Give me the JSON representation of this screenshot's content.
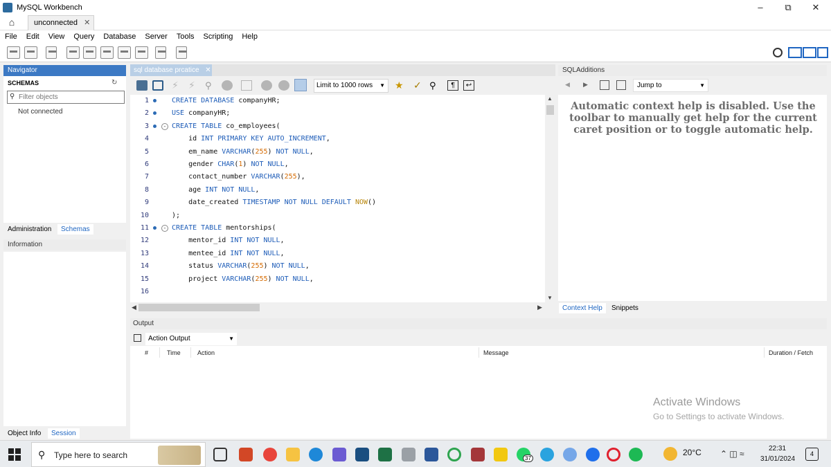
{
  "window": {
    "title": "MySQL Workbench",
    "minimize": "–",
    "maximize": "⧉",
    "close": "✕"
  },
  "tabs": {
    "connection_tab": "unconnected",
    "close": "✕"
  },
  "menu": [
    "File",
    "Edit",
    "View",
    "Query",
    "Database",
    "Server",
    "Tools",
    "Scripting",
    "Help"
  ],
  "navigator": {
    "header": "Navigator",
    "schemas_label": "SCHEMAS",
    "filter_placeholder": "Filter objects",
    "status": "Not connected",
    "tabs": [
      "Administration",
      "Schemas"
    ],
    "info_header": "Information",
    "info_tabs": [
      "Object Info",
      "Session"
    ]
  },
  "editor": {
    "tab_label": "sql database prcatice",
    "tab_close": "✕",
    "limit_select": "Limit to 1000 rows",
    "lines": [
      {
        "n": "1",
        "dot": true,
        "fold": false,
        "html": "<span class='kw'>CREATE DATABASE</span> companyHR;"
      },
      {
        "n": "2",
        "dot": true,
        "fold": false,
        "html": "<span class='kw'>USE</span> companyHR;"
      },
      {
        "n": "3",
        "dot": true,
        "fold": true,
        "html": "<span class='kw'>CREATE TABLE</span> co_employees("
      },
      {
        "n": "4",
        "dot": false,
        "fold": false,
        "html": "    id <span class='kw'>INT PRIMARY KEY AUTO_INCREMENT</span>,"
      },
      {
        "n": "5",
        "dot": false,
        "fold": false,
        "html": "    em_name <span class='kw'>VARCHAR</span>(<span class='num'>255</span>) <span class='kw'>NOT NULL</span>,"
      },
      {
        "n": "6",
        "dot": false,
        "fold": false,
        "html": "    gender <span class='kw'>CHAR</span>(<span class='num'>1</span>) <span class='kw'>NOT NULL</span>,"
      },
      {
        "n": "7",
        "dot": false,
        "fold": false,
        "html": "    contact_number <span class='kw'>VARCHAR</span>(<span class='num'>255</span>),"
      },
      {
        "n": "8",
        "dot": false,
        "fold": false,
        "html": "    age <span class='kw'>INT NOT NULL</span>,"
      },
      {
        "n": "9",
        "dot": false,
        "fold": false,
        "html": "    date_created <span class='kw'>TIMESTAMP NOT NULL DEFAULT</span> <span class='fn'>NOW</span>()"
      },
      {
        "n": "10",
        "dot": false,
        "fold": false,
        "html": ");"
      },
      {
        "n": "11",
        "dot": true,
        "fold": true,
        "html": "<span class='kw'>CREATE TABLE</span> mentorships("
      },
      {
        "n": "12",
        "dot": false,
        "fold": false,
        "html": "    mentor_id <span class='kw'>INT NOT NULL</span>,"
      },
      {
        "n": "13",
        "dot": false,
        "fold": false,
        "html": "    mentee_id <span class='kw'>INT NOT NULL</span>,"
      },
      {
        "n": "14",
        "dot": false,
        "fold": false,
        "html": "    status <span class='kw'>VARCHAR</span>(<span class='num'>255</span>) <span class='kw'>NOT NULL</span>,"
      },
      {
        "n": "15",
        "dot": false,
        "fold": false,
        "html": "    project <span class='kw'>VARCHAR</span>(<span class='num'>255</span>) <span class='kw'>NOT NULL</span>,"
      },
      {
        "n": "16",
        "dot": false,
        "fold": false,
        "html": ""
      }
    ]
  },
  "sql_additions": {
    "header": "SQLAdditions",
    "jump_to": "Jump to",
    "help_text": "Automatic context help is disabled. Use the toolbar to manually get help for the current caret position or to toggle automatic help.",
    "tabs": [
      "Context Help",
      "Snippets"
    ]
  },
  "output": {
    "header": "Output",
    "select": "Action Output",
    "columns": [
      "#",
      "Time",
      "Action",
      "Message",
      "Duration / Fetch"
    ]
  },
  "watermark": {
    "line1": "Activate Windows",
    "line2": "Go to Settings to activate Windows."
  },
  "taskbar": {
    "search": "Type here to search",
    "weather": "20°C",
    "clock_time": "22:31",
    "clock_date": "31/01/2024",
    "notifications": "4",
    "whatsapp_badge": "37"
  },
  "colors": {
    "accent": "#3c79c4",
    "keyword": "#1d5cb8",
    "number": "#d46a00"
  }
}
